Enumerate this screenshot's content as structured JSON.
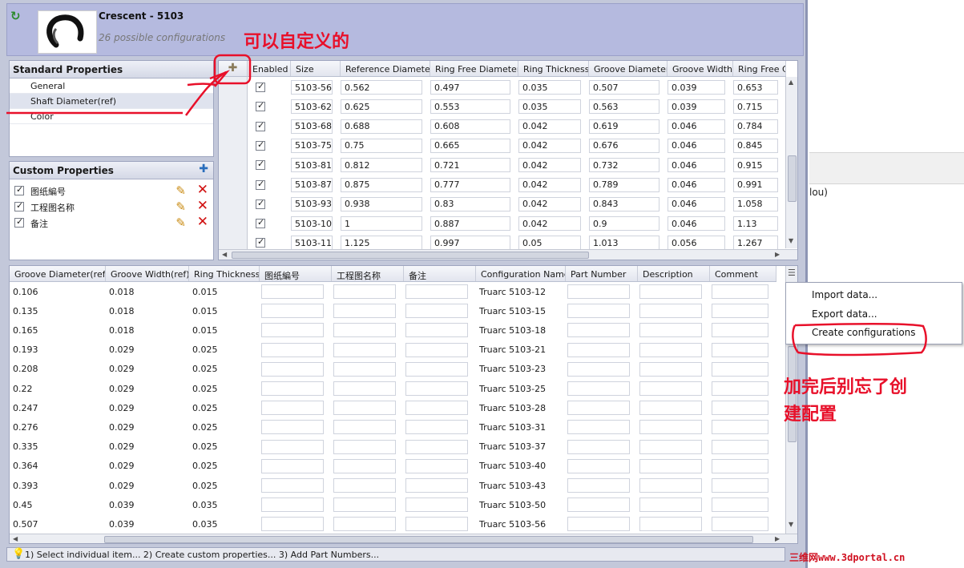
{
  "header": {
    "title": "Crescent - 5103",
    "subtitle": "26 possible configurations"
  },
  "standard_properties": {
    "title": "Standard Properties",
    "items": [
      {
        "label": "General",
        "selected": false
      },
      {
        "label": "Shaft Diameter(ref)",
        "selected": true
      },
      {
        "label": "Color",
        "selected": false
      }
    ]
  },
  "custom_properties": {
    "title": "Custom Properties",
    "items": [
      {
        "label": "图纸編号",
        "checked": true
      },
      {
        "label": "工程图名称",
        "checked": true
      },
      {
        "label": "备注",
        "checked": true
      }
    ]
  },
  "top_grid": {
    "columns": [
      "Enabled",
      "Size",
      "Reference Diameter",
      "Ring Free Diameter",
      "Ring Thickness",
      "Groove Diameter",
      "Groove Width",
      "Ring Free C"
    ],
    "rows": [
      {
        "enabled": true,
        "cells": [
          "5103-56",
          "0.562",
          "0.497",
          "0.035",
          "0.507",
          "0.039",
          "0.653"
        ]
      },
      {
        "enabled": true,
        "cells": [
          "5103-62",
          "0.625",
          "0.553",
          "0.035",
          "0.563",
          "0.039",
          "0.715"
        ]
      },
      {
        "enabled": true,
        "cells": [
          "5103-68",
          "0.688",
          "0.608",
          "0.042",
          "0.619",
          "0.046",
          "0.784"
        ]
      },
      {
        "enabled": true,
        "cells": [
          "5103-75",
          "0.75",
          "0.665",
          "0.042",
          "0.676",
          "0.046",
          "0.845"
        ]
      },
      {
        "enabled": true,
        "cells": [
          "5103-81",
          "0.812",
          "0.721",
          "0.042",
          "0.732",
          "0.046",
          "0.915"
        ]
      },
      {
        "enabled": true,
        "cells": [
          "5103-87",
          "0.875",
          "0.777",
          "0.042",
          "0.789",
          "0.046",
          "0.991"
        ]
      },
      {
        "enabled": true,
        "cells": [
          "5103-93",
          "0.938",
          "0.83",
          "0.042",
          "0.843",
          "0.046",
          "1.058"
        ]
      },
      {
        "enabled": true,
        "cells": [
          "5103-10(",
          "1",
          "0.887",
          "0.042",
          "0.9",
          "0.046",
          "1.13"
        ]
      },
      {
        "enabled": true,
        "cells": [
          "5103-11:",
          "1.125",
          "0.997",
          "0.05",
          "1.013",
          "0.056",
          "1.267"
        ]
      }
    ]
  },
  "bottom_grid": {
    "columns": [
      "Groove Diameter(ref)",
      "Groove Width(ref)",
      "Ring Thickness",
      "图纸編号",
      "工程图名称",
      "备注",
      "Configuration Name",
      "Part Number",
      "Description",
      "Comment"
    ],
    "rows": [
      {
        "cells": [
          "0.106",
          "0.018",
          "0.015",
          "",
          "",
          "",
          "Truarc 5103-12",
          "",
          "",
          ""
        ]
      },
      {
        "cells": [
          "0.135",
          "0.018",
          "0.015",
          "",
          "",
          "",
          "Truarc 5103-15",
          "",
          "",
          ""
        ]
      },
      {
        "cells": [
          "0.165",
          "0.018",
          "0.015",
          "",
          "",
          "",
          "Truarc 5103-18",
          "",
          "",
          ""
        ]
      },
      {
        "cells": [
          "0.193",
          "0.029",
          "0.025",
          "",
          "",
          "",
          "Truarc 5103-21",
          "",
          "",
          ""
        ]
      },
      {
        "cells": [
          "0.208",
          "0.029",
          "0.025",
          "",
          "",
          "",
          "Truarc 5103-23",
          "",
          "",
          ""
        ]
      },
      {
        "cells": [
          "0.22",
          "0.029",
          "0.025",
          "",
          "",
          "",
          "Truarc 5103-25",
          "",
          "",
          ""
        ]
      },
      {
        "cells": [
          "0.247",
          "0.029",
          "0.025",
          "",
          "",
          "",
          "Truarc 5103-28",
          "",
          "",
          ""
        ]
      },
      {
        "cells": [
          "0.276",
          "0.029",
          "0.025",
          "",
          "",
          "",
          "Truarc 5103-31",
          "",
          "",
          ""
        ]
      },
      {
        "cells": [
          "0.335",
          "0.029",
          "0.025",
          "",
          "",
          "",
          "Truarc 5103-37",
          "",
          "",
          ""
        ]
      },
      {
        "cells": [
          "0.364",
          "0.029",
          "0.025",
          "",
          "",
          "",
          "Truarc 5103-40",
          "",
          "",
          ""
        ]
      },
      {
        "cells": [
          "0.393",
          "0.029",
          "0.025",
          "",
          "",
          "",
          "Truarc 5103-43",
          "",
          "",
          ""
        ]
      },
      {
        "cells": [
          "0.45",
          "0.039",
          "0.035",
          "",
          "",
          "",
          "Truarc 5103-50",
          "",
          "",
          ""
        ]
      },
      {
        "cells": [
          "0.507",
          "0.039",
          "0.035",
          "",
          "",
          "",
          "Truarc 5103-56",
          "",
          "",
          ""
        ]
      }
    ]
  },
  "context_menu": {
    "items": [
      "Import data...",
      "Export data...",
      "Create configurations"
    ]
  },
  "status_bar": {
    "text": "1) Select individual item... 2) Create custom properties... 3) Add Part Numbers..."
  },
  "annotations": {
    "top": "可以自定义的",
    "right_line1": "加完后别忘了创",
    "right_line2": "建配置",
    "color": "#e8102a"
  },
  "background_fragment": "lou)",
  "watermark": "三维网www.3dportal.cn",
  "icons": {
    "back": "green-back-arrow-icon",
    "add_column": "add-column-icon",
    "add_property": "add-property-icon",
    "edit": "pencil-icon",
    "delete": "red-x-icon",
    "column_menu": "column-menu-icon",
    "status_hint": "lightbulb-icon"
  }
}
